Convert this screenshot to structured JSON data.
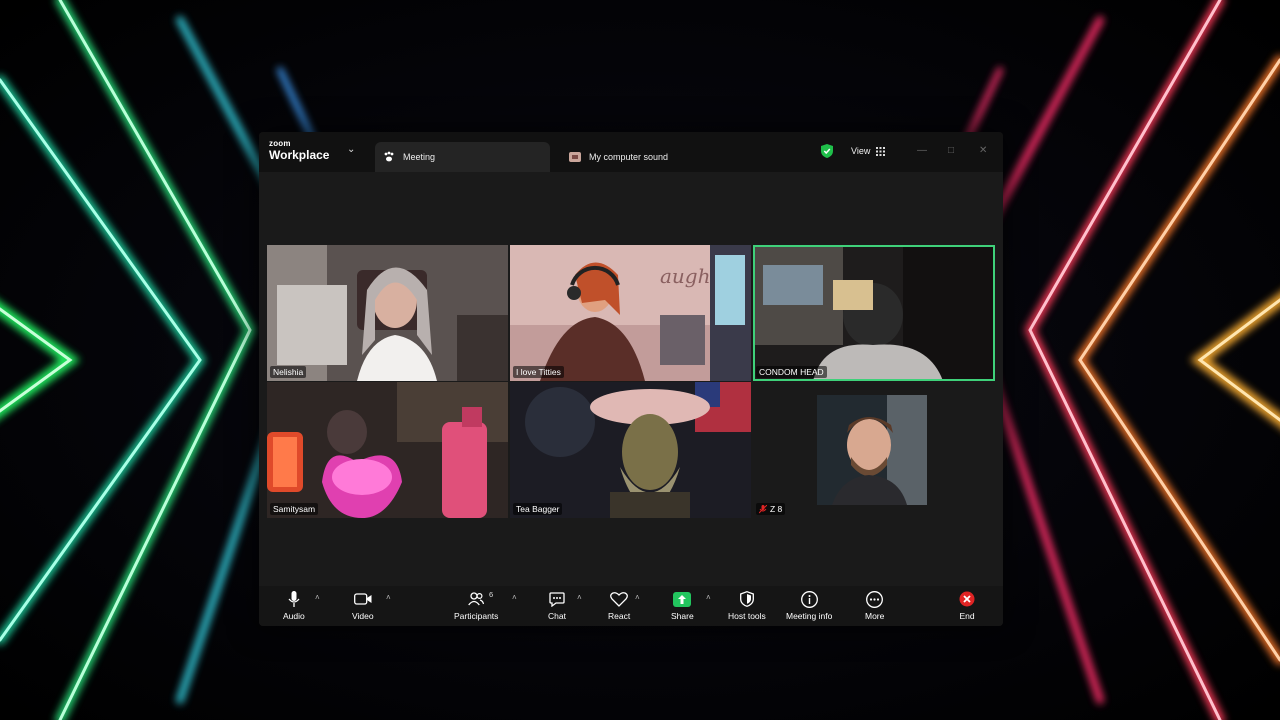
{
  "app": {
    "brand_top": "zoom",
    "brand_bottom": "Workplace",
    "tab_meeting": "Meeting",
    "tab_sound": "My computer sound",
    "view_label": "View"
  },
  "participants": [
    {
      "name": "Nelishia"
    },
    {
      "name": "I love Titties"
    },
    {
      "name": "CONDOM HEAD",
      "speaking": true
    },
    {
      "name": "Samitysam"
    },
    {
      "name": "Tea Bagger"
    },
    {
      "name": "Z 8",
      "muted": true
    }
  ],
  "toolbar": {
    "audio": "Audio",
    "video": "Video",
    "participants": "Participants",
    "participants_count": "6",
    "chat": "Chat",
    "react": "React",
    "share": "Share",
    "host_tools": "Host tools",
    "meeting_info": "Meeting info",
    "more": "More",
    "end": "End"
  },
  "colors": {
    "speaking_border": "#3fd17a",
    "share_green": "#22c55e",
    "end_red": "#e02424",
    "shield_green": "#1fbf4a"
  }
}
